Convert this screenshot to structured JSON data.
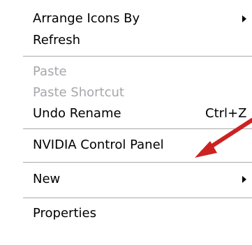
{
  "menu": {
    "arrange": {
      "label": "Arrange Icons By"
    },
    "refresh": {
      "label": "Refresh"
    },
    "paste": {
      "label": "Paste"
    },
    "paste_shortcut": {
      "label": "Paste Shortcut"
    },
    "undo": {
      "label": "Undo Rename",
      "shortcut": "Ctrl+Z"
    },
    "nvidia": {
      "label": "NVIDIA Control Panel"
    },
    "new": {
      "label": "New"
    },
    "properties": {
      "label": "Properties"
    }
  },
  "icons": {
    "submenu": "submenu-arrow-icon",
    "annotation": "red-pointer-arrow"
  },
  "colors": {
    "text": "#000000",
    "disabled_text": "#a7a6aa",
    "separator": "#a9a9a9",
    "annotation_arrow": "#cc2222"
  }
}
